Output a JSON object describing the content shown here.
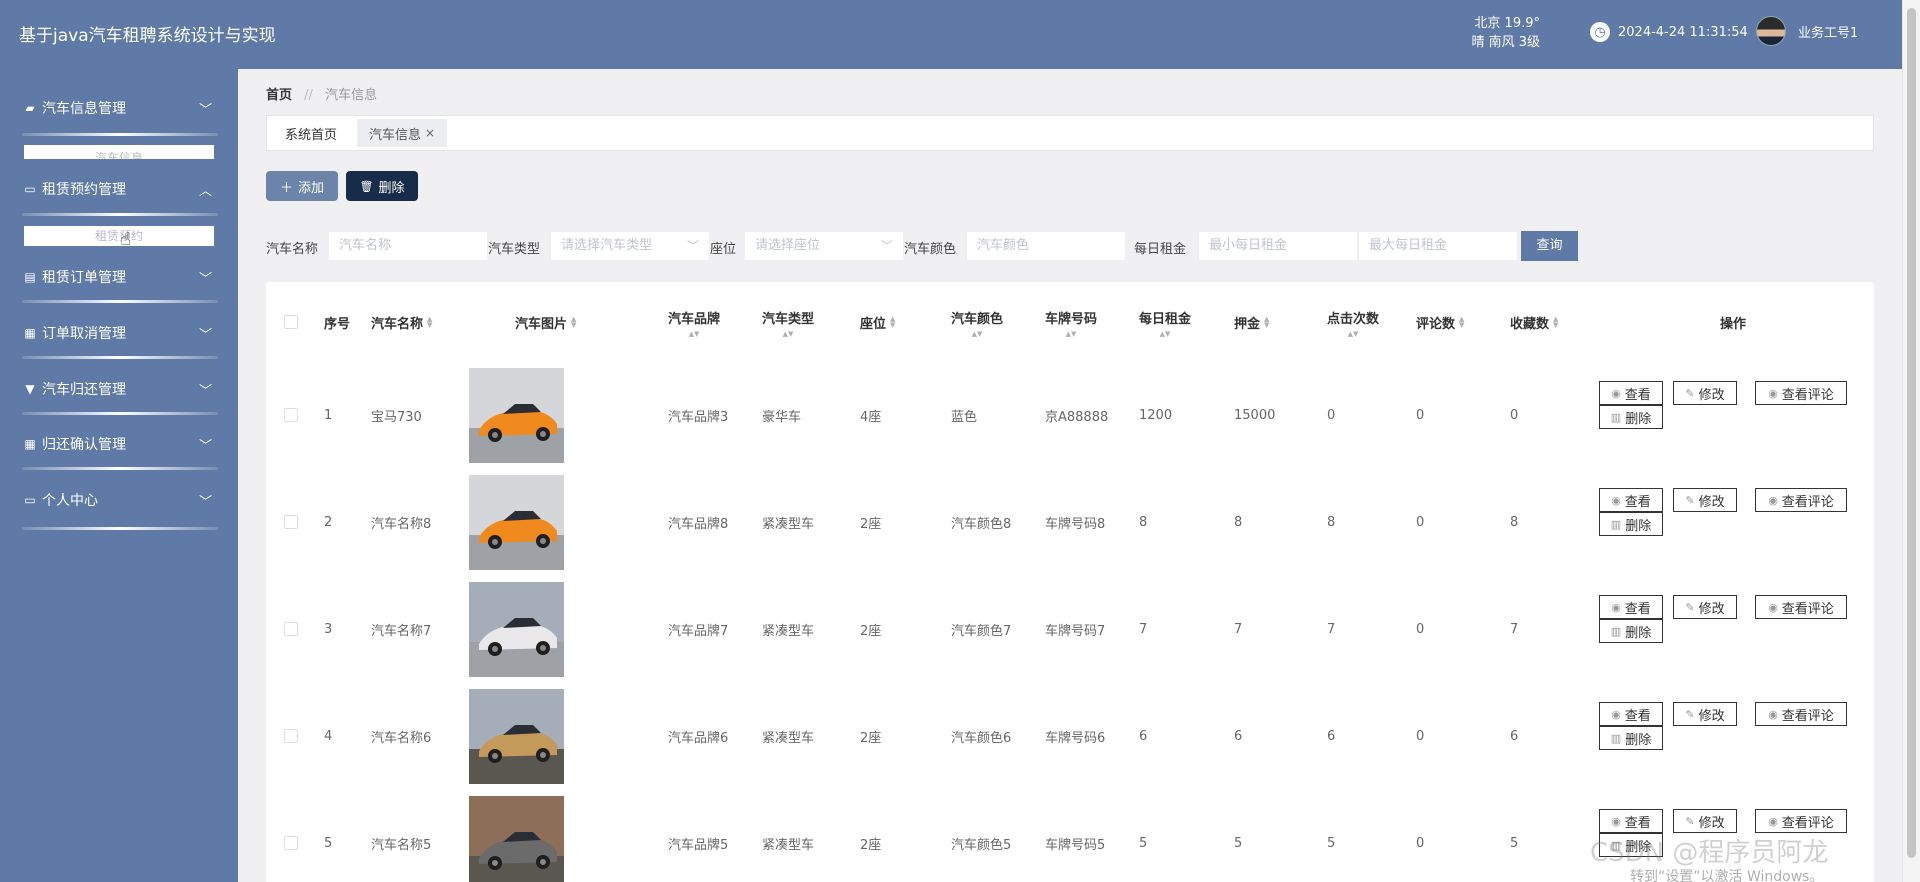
{
  "header": {
    "title": "基于java汽车租聘系统设计与实现",
    "weather_city": "北京  19.9°",
    "weather_detail": "晴  南风  3级",
    "datetime": "2024-4-24 11:31:54",
    "username": "业务工号1"
  },
  "sidebar": {
    "items": [
      {
        "label": "汽车信息管理",
        "chevron": "﹀"
      },
      {
        "label": "租赁预约管理",
        "chevron": "︿"
      },
      {
        "label": "租赁订单管理",
        "chevron": "﹀"
      },
      {
        "label": "订单取消管理",
        "chevron": "﹀"
      },
      {
        "label": "汽车归还管理",
        "chevron": "﹀"
      },
      {
        "label": "归还确认管理",
        "chevron": "﹀"
      },
      {
        "label": "个人中心",
        "chevron": "﹀"
      }
    ],
    "submenu_1": "汽车信息",
    "submenu_2": "租赁预约"
  },
  "breadcrumb": {
    "home": "首页",
    "sep": "//",
    "current": "汽车信息"
  },
  "tabs": [
    {
      "label": "系统首页"
    },
    {
      "label": "汽车信息",
      "close": "×"
    }
  ],
  "toolbar": {
    "add_label": "添加",
    "delete_label": "删除"
  },
  "filters": {
    "name_label": "汽车名称",
    "name_placeholder": "汽车名称",
    "type_label": "汽车类型",
    "type_placeholder": "请选择汽车类型",
    "seat_label": "座位",
    "seat_placeholder": "请选择座位",
    "color_label": "汽车颜色",
    "color_placeholder": "汽车颜色",
    "rent_label": "每日租金",
    "rent_min_placeholder": "最小每日租金",
    "rent_max_placeholder": "最大每日租金",
    "search_label": "查询"
  },
  "table": {
    "headers": {
      "index": "序号",
      "name": "汽车名称",
      "image": "汽车图片",
      "brand": "汽车品牌",
      "type": "汽车类型",
      "seat": "座位",
      "color": "汽车颜色",
      "plate": "车牌号码",
      "rent": "每日租金",
      "deposit": "押金",
      "clicks": "点击次数",
      "comments": "评论数",
      "favorites": "收藏数",
      "ops": "操作"
    },
    "ops": {
      "view": "查看",
      "edit": "修改",
      "comments": "查看评论",
      "delete": "删除"
    },
    "rows": [
      {
        "index": "1",
        "name": "宝马730",
        "brand": "汽车品牌3",
        "type": "豪华车",
        "seat": "4座",
        "color": "蓝色",
        "plate": "京A88888",
        "rent": "1200",
        "deposit": "15000",
        "clicks": "0",
        "comments": "0",
        "favorites": "0",
        "car_color": "#f08a1e"
      },
      {
        "index": "2",
        "name": "汽车名称8",
        "brand": "汽车品牌8",
        "type": "紧凑型车",
        "seat": "2座",
        "color": "汽车颜色8",
        "plate": "车牌号码8",
        "rent": "8",
        "deposit": "8",
        "clicks": "8",
        "comments": "0",
        "favorites": "8",
        "car_color": "#f08a1e"
      },
      {
        "index": "3",
        "name": "汽车名称7",
        "brand": "汽车品牌7",
        "type": "紧凑型车",
        "seat": "2座",
        "color": "汽车颜色7",
        "plate": "车牌号码7",
        "rent": "7",
        "deposit": "7",
        "clicks": "7",
        "comments": "0",
        "favorites": "7",
        "car_color": "#e8e8ea"
      },
      {
        "index": "4",
        "name": "汽车名称6",
        "brand": "汽车品牌6",
        "type": "紧凑型车",
        "seat": "2座",
        "color": "汽车颜色6",
        "plate": "车牌号码6",
        "rent": "6",
        "deposit": "6",
        "clicks": "6",
        "comments": "0",
        "favorites": "6",
        "car_color": "#c49a5a"
      },
      {
        "index": "5",
        "name": "汽车名称5",
        "brand": "汽车品牌5",
        "type": "紧凑型车",
        "seat": "2座",
        "color": "汽车颜色5",
        "plate": "车牌号码5",
        "rent": "5",
        "deposit": "5",
        "clicks": "5",
        "comments": "0",
        "favorites": "5",
        "car_color": "#6b6b6b"
      }
    ]
  },
  "watermark": {
    "line1": "CSDN @程序员阿龙",
    "line2": "转到“设置”以激活 Windows。"
  },
  "colors": {
    "primary": "#5f7aa6",
    "dark_button": "#162c48",
    "page_bg": "#f0f0f2"
  }
}
